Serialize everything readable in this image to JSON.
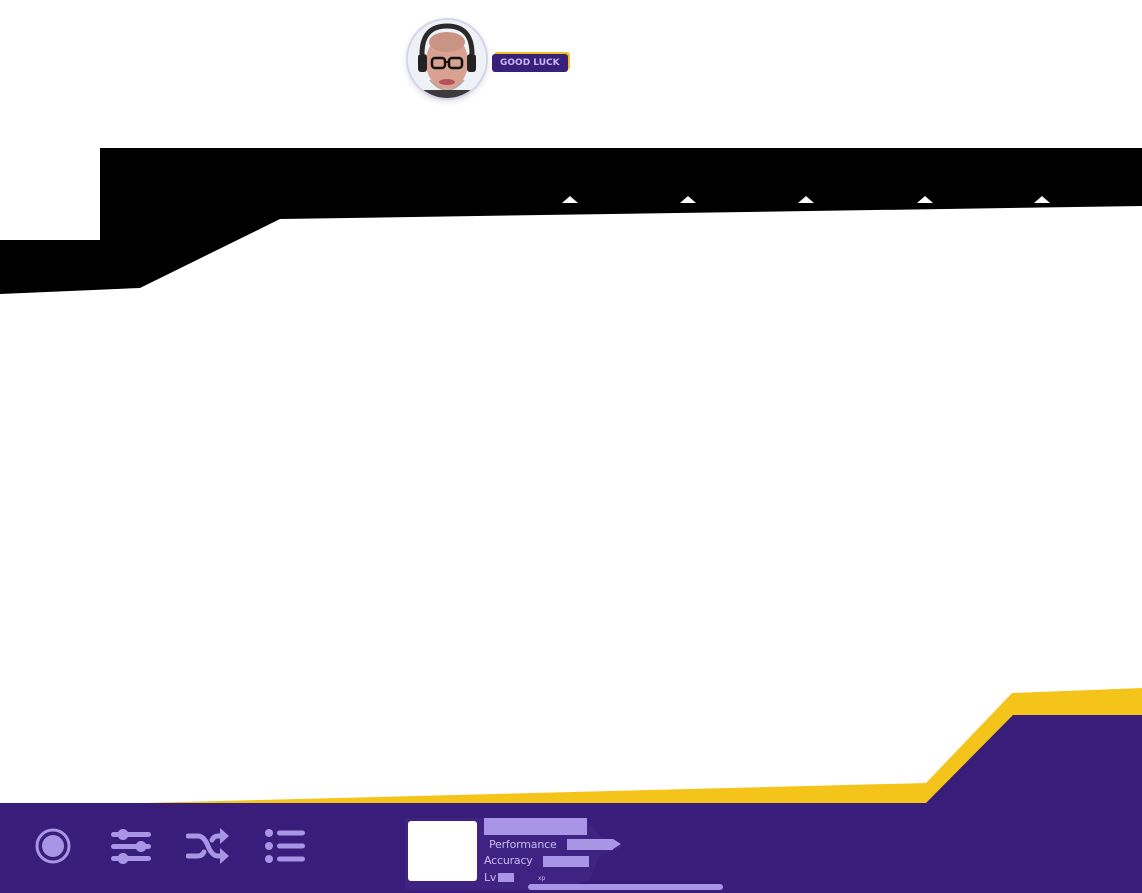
{
  "header": {
    "avatar_name": "user-avatar",
    "badge_text": "GOOD LUCK"
  },
  "colors": {
    "bar_dark": "#000000",
    "footer_purple": "#381e7a",
    "accent_yellow": "#f5c41a",
    "icon_lilac": "#a995e6"
  },
  "toolbar": {
    "items": [
      {
        "name": "record-icon"
      },
      {
        "name": "sliders-icon"
      },
      {
        "name": "shuffle-icon"
      },
      {
        "name": "list-icon"
      }
    ]
  },
  "profile": {
    "performance_label": "Performance",
    "accuracy_label": "Accuracy",
    "level_label": "Lv",
    "xp_label": "xp",
    "xp_progress": 1.0
  }
}
